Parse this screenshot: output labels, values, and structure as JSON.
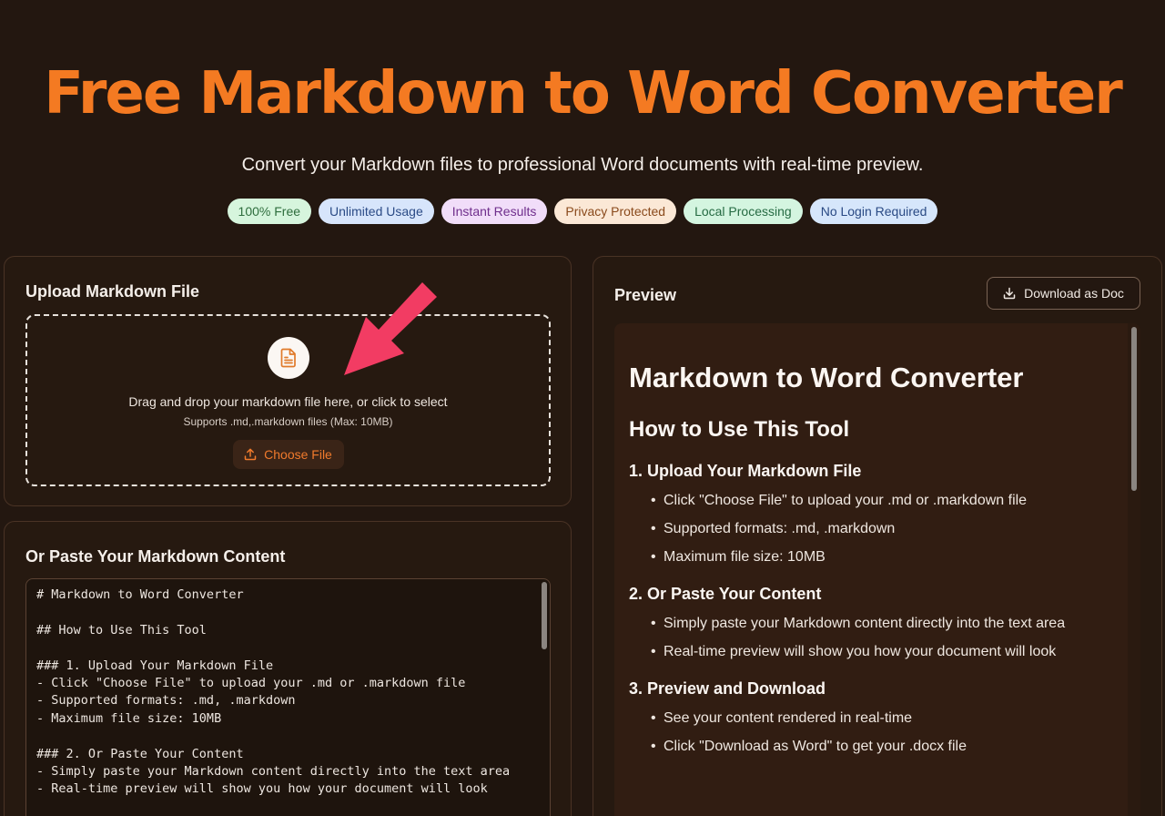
{
  "hero": {
    "title": "Free Markdown to Word Converter",
    "subtitle": "Convert your Markdown files to professional Word documents with real-time preview."
  },
  "badges": [
    "100% Free",
    "Unlimited Usage",
    "Instant Results",
    "Privacy Protected",
    "Local Processing",
    "No Login Required"
  ],
  "upload": {
    "title": "Upload Markdown File",
    "drop_text": "Drag and drop your markdown file here, or click to select",
    "drop_sub": "Supports .md,.markdown files (Max: 10MB)",
    "choose_label": "Choose File"
  },
  "paste": {
    "title": "Or Paste Your Markdown Content",
    "content": "# Markdown to Word Converter\n\n## How to Use This Tool\n\n### 1. Upload Your Markdown File\n- Click \"Choose File\" to upload your .md or .markdown file\n- Supported formats: .md, .markdown\n- Maximum file size: 10MB\n\n### 2. Or Paste Your Content\n- Simply paste your Markdown content directly into the text area\n- Real-time preview will show you how your document will look"
  },
  "preview": {
    "title": "Preview",
    "download_label": "Download as Doc",
    "h1": "Markdown to Word Converter",
    "h2": "How to Use This Tool",
    "sections": [
      {
        "heading": "1. Upload Your Markdown File",
        "items": [
          "Click \"Choose File\" to upload your .md or .markdown file",
          "Supported formats: .md, .markdown",
          "Maximum file size: 10MB"
        ]
      },
      {
        "heading": "2. Or Paste Your Content",
        "items": [
          "Simply paste your Markdown content directly into the text area",
          "Real-time preview will show you how your document will look"
        ]
      },
      {
        "heading": "3. Preview and Download",
        "items": [
          "See your content rendered in real-time",
          "Click \"Download as Word\" to get your .docx file"
        ]
      }
    ]
  },
  "colors": {
    "accent": "#f47a22",
    "background": "#231710",
    "annotation_arrow": "#f23c63"
  }
}
